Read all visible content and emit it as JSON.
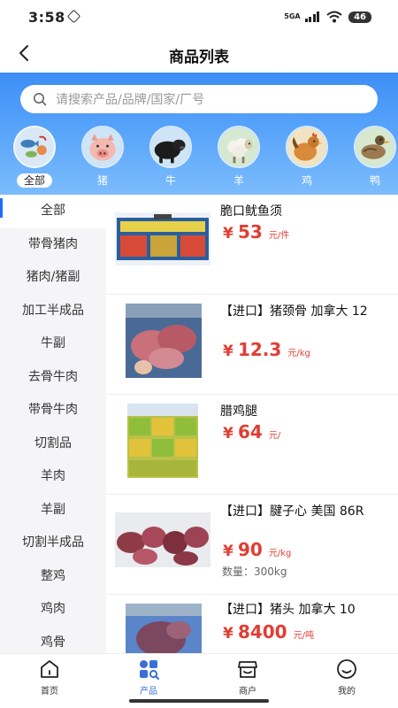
{
  "status": {
    "time": "3:58",
    "signal": "5GA",
    "battery": "46"
  },
  "nav": {
    "title": "商品列表"
  },
  "search": {
    "placeholder": "请搜索产品/品牌/国家/厂号"
  },
  "categories": [
    {
      "label": "全部",
      "icon": "seafood-all-icon",
      "active": true
    },
    {
      "label": "猪",
      "icon": "pig-icon"
    },
    {
      "label": "牛",
      "icon": "cow-icon"
    },
    {
      "label": "羊",
      "icon": "sheep-icon"
    },
    {
      "label": "鸡",
      "icon": "chicken-icon"
    },
    {
      "label": "鸭",
      "icon": "duck-icon"
    }
  ],
  "sidebar": {
    "items": [
      {
        "label": "全部",
        "active": true
      },
      {
        "label": "带骨猪肉"
      },
      {
        "label": "猪肉/猪副"
      },
      {
        "label": "加工半成品"
      },
      {
        "label": "牛副"
      },
      {
        "label": "去骨牛肉"
      },
      {
        "label": "带骨牛肉"
      },
      {
        "label": "切割品"
      },
      {
        "label": "羊肉"
      },
      {
        "label": "羊副"
      },
      {
        "label": "切割半成品"
      },
      {
        "label": "整鸡"
      },
      {
        "label": "鸡肉"
      },
      {
        "label": "鸡骨"
      }
    ]
  },
  "products": [
    {
      "name": "脆口鱿鱼须",
      "currency": "¥",
      "price": "53",
      "unit": "元/件"
    },
    {
      "name": "【进口】猪颈骨 加拿大 12",
      "currency": "¥",
      "price": "12.3",
      "unit": "元/kg"
    },
    {
      "name": "腊鸡腿",
      "currency": "¥",
      "price": "64",
      "unit": "元/"
    },
    {
      "name": "【进口】腱子心 美国 86R",
      "currency": "¥",
      "price": "90",
      "unit": "元/kg",
      "qty_label": "数量：",
      "qty": "300kg"
    },
    {
      "name": "【进口】猪头 加拿大 10",
      "currency": "¥",
      "price": "8400",
      "unit": "元/吨"
    }
  ],
  "tabs": [
    {
      "label": "首页",
      "icon": "home-icon"
    },
    {
      "label": "产品",
      "icon": "products-icon",
      "active": true
    },
    {
      "label": "商户",
      "icon": "shop-icon"
    },
    {
      "label": "我的",
      "icon": "profile-icon"
    }
  ],
  "colors": {
    "accent": "#1e6ef5",
    "price": "#e23d33",
    "header": "#4e9bf8"
  }
}
